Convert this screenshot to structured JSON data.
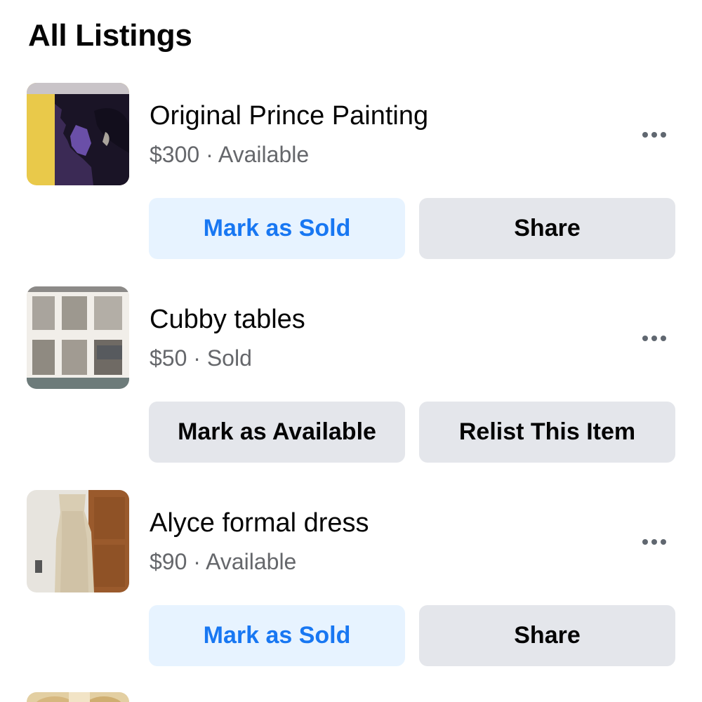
{
  "section": {
    "title": "All Listings"
  },
  "listings": [
    {
      "title": "Original Prince Painting",
      "price": "$300",
      "separator": "·",
      "status": "Available",
      "primary_action": "Mark as Sold",
      "secondary_action": "Share",
      "more_icon": "more-horizontal-icon",
      "thumbnail": "painting-thumbnail"
    },
    {
      "title": "Cubby tables",
      "price": "$50",
      "separator": "·",
      "status": "Sold",
      "primary_action": "Mark as Available",
      "secondary_action": "Relist This Item",
      "more_icon": "more-horizontal-icon",
      "thumbnail": "cubby-tables-thumbnail"
    },
    {
      "title": "Alyce formal dress",
      "price": "$90",
      "separator": "·",
      "status": "Available",
      "primary_action": "Mark as Sold",
      "secondary_action": "Share",
      "more_icon": "more-horizontal-icon",
      "thumbnail": "dress-thumbnail"
    }
  ],
  "colors": {
    "primary_button_bg": "#e7f3ff",
    "primary_button_text": "#1877f2",
    "secondary_button_bg": "#e4e6eb",
    "meta_text": "#65676b"
  }
}
